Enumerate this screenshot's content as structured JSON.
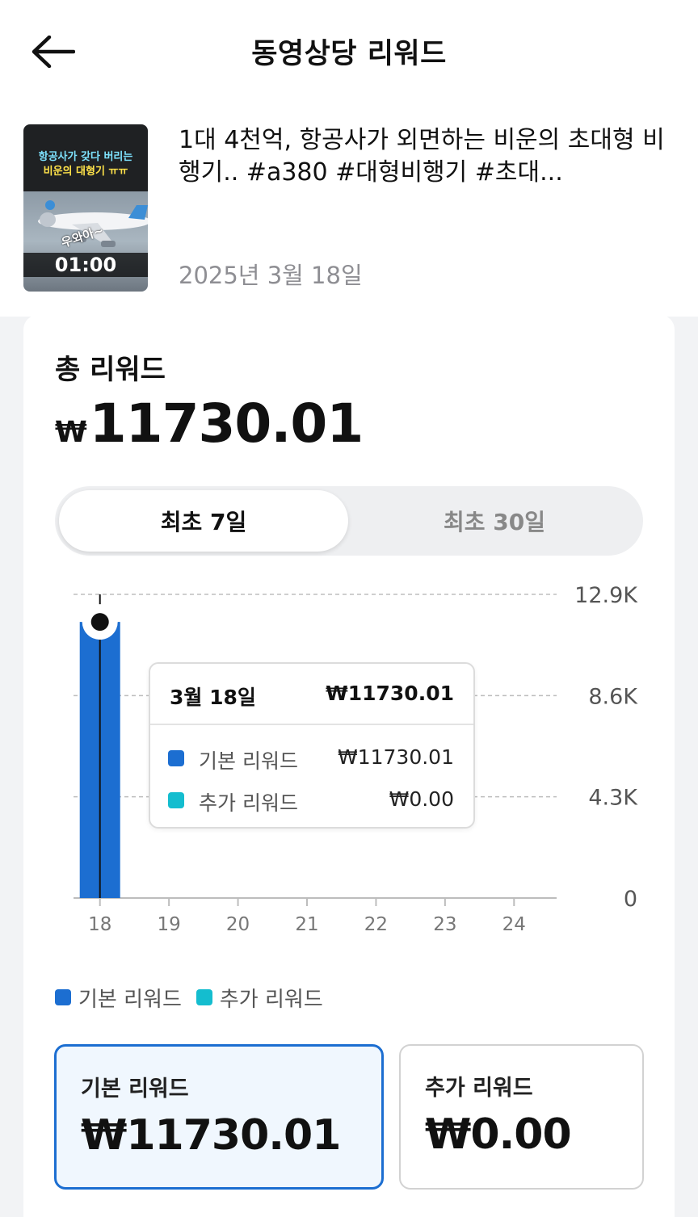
{
  "header": {
    "title": "동영상당 리워드",
    "back_icon": "arrow-left-icon"
  },
  "video": {
    "title": "1대 4천억, 항공사가 외면하는 비운의 초대형 비행기.. #a380 #대형비행기 #초대...",
    "date": "2025년 3월 18일",
    "thumbnail": {
      "caption_line1": "항공사가 갖다 버리는",
      "caption_line2": "비운의 대형기 ㅠㅠ",
      "sticker": "우와아~",
      "duration": "01:00"
    }
  },
  "summary": {
    "total_label": "총 리워드",
    "currency": "₩",
    "total_value": "11730.01"
  },
  "period_tabs": [
    {
      "label": "최초 7일",
      "active": true
    },
    {
      "label": "최초 30일",
      "active": false
    }
  ],
  "chart_data": {
    "type": "bar",
    "categories": [
      "18",
      "19",
      "20",
      "21",
      "22",
      "23",
      "24"
    ],
    "series": [
      {
        "name": "기본 리워드",
        "color": "#1c6ed1",
        "values": [
          11730.01,
          0,
          0,
          0,
          0,
          0,
          0
        ]
      },
      {
        "name": "추가 리워드",
        "color": "#14bdcf",
        "values": [
          0,
          0,
          0,
          0,
          0,
          0,
          0
        ]
      }
    ],
    "y_ticks": [
      "0",
      "4.3K",
      "8.6K",
      "12.9K"
    ],
    "ylim": [
      0,
      12900
    ],
    "grid": true,
    "selected_index": 0,
    "tooltip": {
      "date": "3월 18일",
      "total": "₩11730.01",
      "rows": [
        {
          "name": "기본 리워드",
          "value": "₩11730.01",
          "color": "#1c6ed1"
        },
        {
          "name": "추가 리워드",
          "value": "₩0.00",
          "color": "#14bdcf"
        }
      ]
    }
  },
  "legend": [
    {
      "label": "기본 리워드",
      "color": "#1c6ed1"
    },
    {
      "label": "추가 리워드",
      "color": "#14bdcf"
    }
  ],
  "stats": [
    {
      "label": "기본 리워드",
      "value": "₩11730.01",
      "selected": true
    },
    {
      "label": "추가 리워드",
      "value": "₩0.00",
      "selected": false
    }
  ]
}
